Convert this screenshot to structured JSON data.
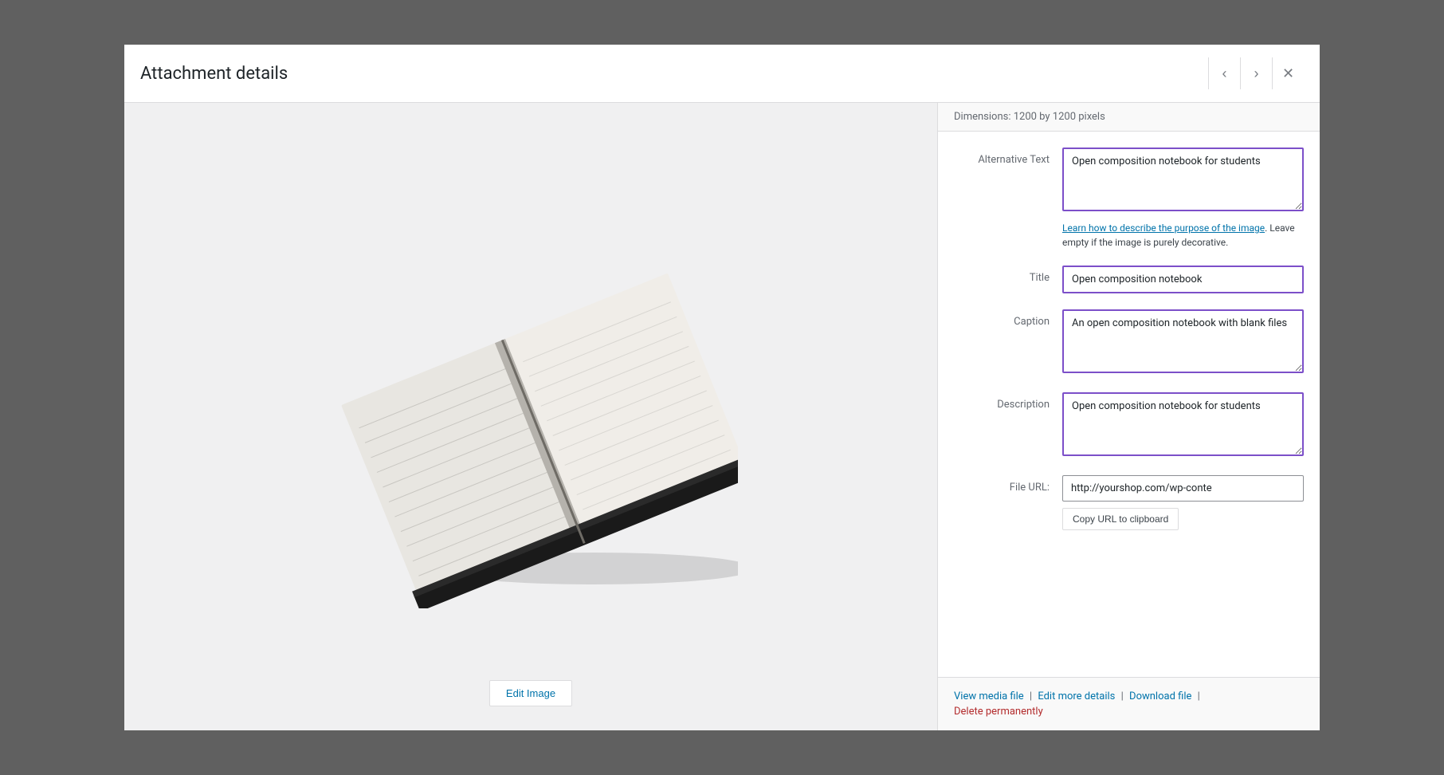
{
  "modal": {
    "title": "Attachment details",
    "dimensions_label": "Dimensions:",
    "dimensions_value": "1200 by 1200 pixels"
  },
  "nav": {
    "prev_label": "‹",
    "next_label": "›",
    "close_label": "✕"
  },
  "form": {
    "alt_text_label": "Alternative Text",
    "alt_text_value": "Open composition notebook for students",
    "alt_text_help_link": "Learn how to describe the purpose of the image",
    "alt_text_help_text": ". Leave empty if the image is purely decorative.",
    "title_label": "Title",
    "title_value": "Open composition notebook",
    "caption_label": "Caption",
    "caption_value": "An open composition notebook with blank files",
    "description_label": "Description",
    "description_value": "Open composition notebook for students",
    "file_url_label": "File URL:",
    "file_url_value": "http://yourshop.com/wp-conte",
    "copy_url_btn": "Copy URL to clipboard"
  },
  "footer": {
    "view_media": "View media file",
    "edit_details": "Edit more details",
    "download": "Download file",
    "delete": "Delete permanently"
  },
  "edit_image_btn": "Edit Image"
}
